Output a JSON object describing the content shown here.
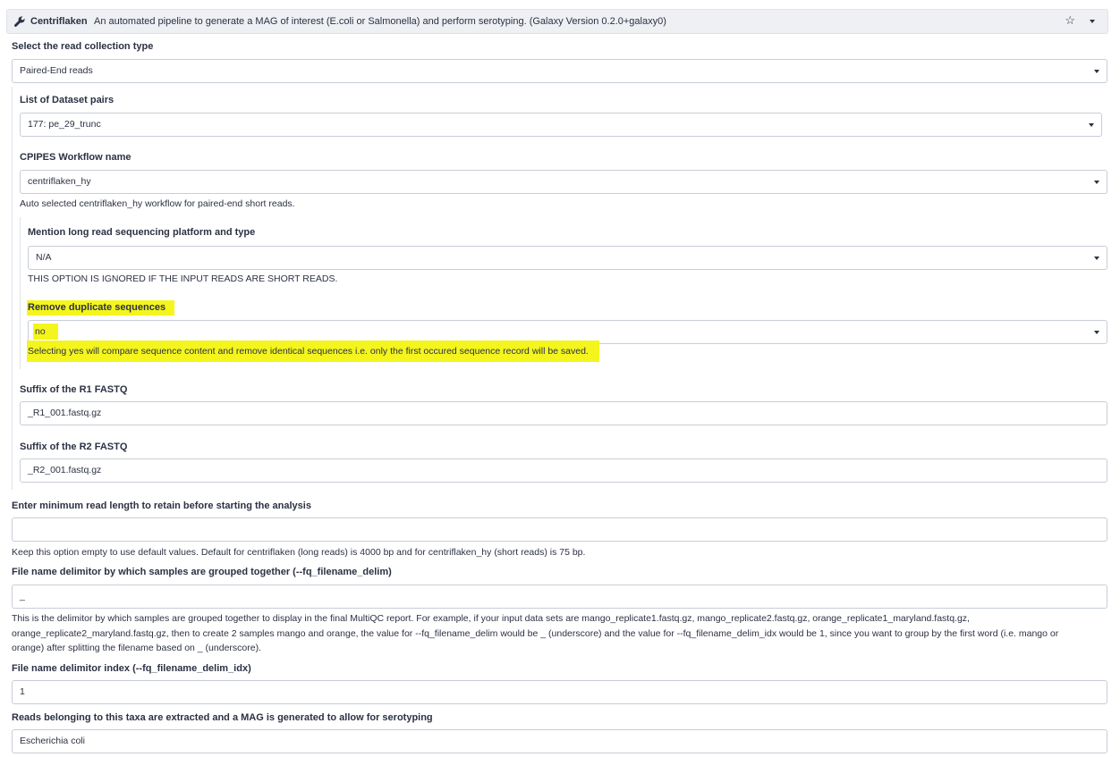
{
  "header": {
    "title": "Centriflaken",
    "description": "An automated pipeline to generate a MAG of interest (E.coli or Salmonella) and perform serotyping. (Galaxy Version 0.2.0+galaxy0)",
    "icons": [
      "wrench-icon",
      "star-icon",
      "chevron-down-icon"
    ]
  },
  "read_collection": {
    "label": "Select the read collection type",
    "value": "Paired-End reads"
  },
  "dataset_pairs": {
    "label": "List of Dataset pairs",
    "value": "177: pe_29_trunc"
  },
  "workflow": {
    "label": "CPIPES Workflow name",
    "value": "centriflaken_hy",
    "help": "Auto selected centriflaken_hy workflow for paired-end short reads."
  },
  "long_read_platform": {
    "label": "Mention long read sequencing platform and type",
    "value": "N/A",
    "help": "THIS OPTION IS IGNORED IF THE INPUT READS ARE SHORT READS."
  },
  "remove_duplicates": {
    "label": "Remove duplicate sequences",
    "value": "no",
    "help": "Selecting yes will compare sequence content and remove identical sequences i.e. only the first occured sequence record will be saved.",
    "highlight_color": "#f5f51e"
  },
  "suffix_r1": {
    "label": "Suffix of the R1 FASTQ",
    "value": "_R1_001.fastq.gz"
  },
  "suffix_r2": {
    "label": "Suffix of the R2 FASTQ",
    "value": "_R2_001.fastq.gz"
  },
  "min_read_length": {
    "label": "Enter minimum read length to retain before starting the analysis",
    "value": "",
    "help": "Keep this option empty to use default values. Default for centriflaken (long reads) is 4000 bp and for centriflaken_hy (short reads) is 75 bp."
  },
  "filename_delim": {
    "label": "File name delimitor by which samples are grouped together (--fq_filename_delim)",
    "value": "_",
    "help_lines": [
      "This is the delimitor by which samples are grouped together to display in the final MultiQC report. For example, if your input data sets are mango_replicate1.fastq.gz, mango_replicate2.fastq.gz, orange_replicate1_maryland.fastq.gz,",
      "orange_replicate2_maryland.fastq.gz, then to create 2 samples mango and orange, the value for --fq_filename_delim would be _ (underscore) and the value for --fq_filename_delim_idx would be 1, since you want to group by the first word (i.e. mango or",
      "orange) after splitting the filename based on _ (underscore)."
    ]
  },
  "filename_delim_idx": {
    "label": "File name delimitor index (--fq_filename_delim_idx)",
    "value": "1"
  },
  "taxa": {
    "label": "Reads belonging to this taxa are extracted and a MAG is generated to allow for serotyping",
    "value": "Escherichia coli"
  }
}
